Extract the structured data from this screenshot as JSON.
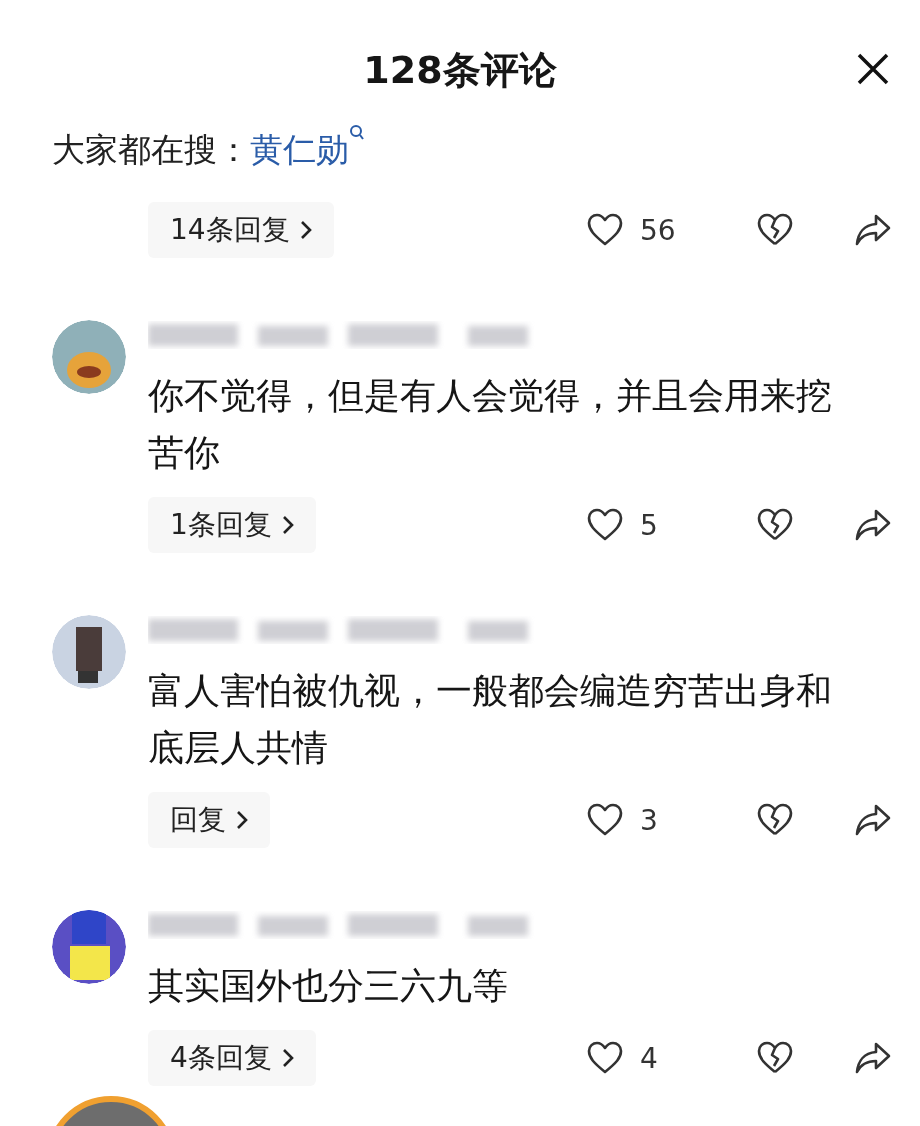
{
  "header": {
    "title": "128条评论"
  },
  "search_suggestion": {
    "label": "大家都在搜：",
    "term": "黄仁勋"
  },
  "top_reply_bar": {
    "replies": "14条回复",
    "likes": "56"
  },
  "comments": [
    {
      "text": "你不觉得，但是有人会觉得，并且会用来挖苦你",
      "replies": "1条回复",
      "likes": "5"
    },
    {
      "text": "富人害怕被仇视，一般都会编造穷苦出身和底层人共情",
      "replies": "回复",
      "likes": "3"
    },
    {
      "text": "其实国外也分三六九等",
      "replies": "4条回复",
      "likes": "4"
    }
  ]
}
